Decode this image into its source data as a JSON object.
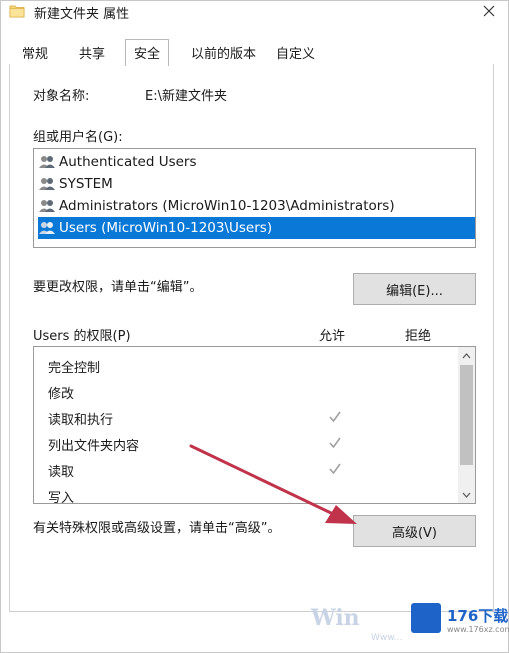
{
  "window": {
    "title": "新建文件夹 属性",
    "close_glyph": "✕"
  },
  "tabs": [
    {
      "label": "常规"
    },
    {
      "label": "共享"
    },
    {
      "label": "安全",
      "active": true
    },
    {
      "label": "以前的版本"
    },
    {
      "label": "自定义"
    }
  ],
  "object": {
    "label": "对象名称:",
    "value": "E:\\新建文件夹"
  },
  "groups": {
    "label": "组或用户名(G):",
    "items": [
      {
        "label": "Authenticated Users",
        "icon": "users-icon"
      },
      {
        "label": "SYSTEM",
        "icon": "users-icon"
      },
      {
        "label": "Administrators (MicroWin10-1203\\Administrators)",
        "icon": "users-icon"
      },
      {
        "label": "Users (MicroWin10-1203\\Users)",
        "icon": "users-icon",
        "selected": true
      }
    ]
  },
  "edit": {
    "hint": "要更改权限，请单击“编辑”。",
    "button": "编辑(E)..."
  },
  "permissions": {
    "label": "Users 的权限(P)",
    "allow_header": "允许",
    "deny_header": "拒绝",
    "items": [
      {
        "name": "完全控制",
        "allow": false,
        "deny": false
      },
      {
        "name": "修改",
        "allow": false,
        "deny": false
      },
      {
        "name": "读取和执行",
        "allow": true,
        "deny": false
      },
      {
        "name": "列出文件夹内容",
        "allow": true,
        "deny": false
      },
      {
        "name": "读取",
        "allow": true,
        "deny": false
      },
      {
        "name": "写入",
        "allow": false,
        "deny": false
      }
    ],
    "scroll_up_glyph": "˄",
    "scroll_down_glyph": "˅"
  },
  "advanced": {
    "hint": "有关特殊权限或高级设置，请单击“高级”。",
    "button": "高级(V)"
  },
  "watermark": {
    "brand": "176下载网",
    "url": "www.176xz.com",
    "win_text": "Win",
    "win_url": "Www..."
  },
  "colors": {
    "selection": "#0a78d7",
    "annotation_arrow": "#c0334a",
    "check": "#a0a0a0"
  }
}
